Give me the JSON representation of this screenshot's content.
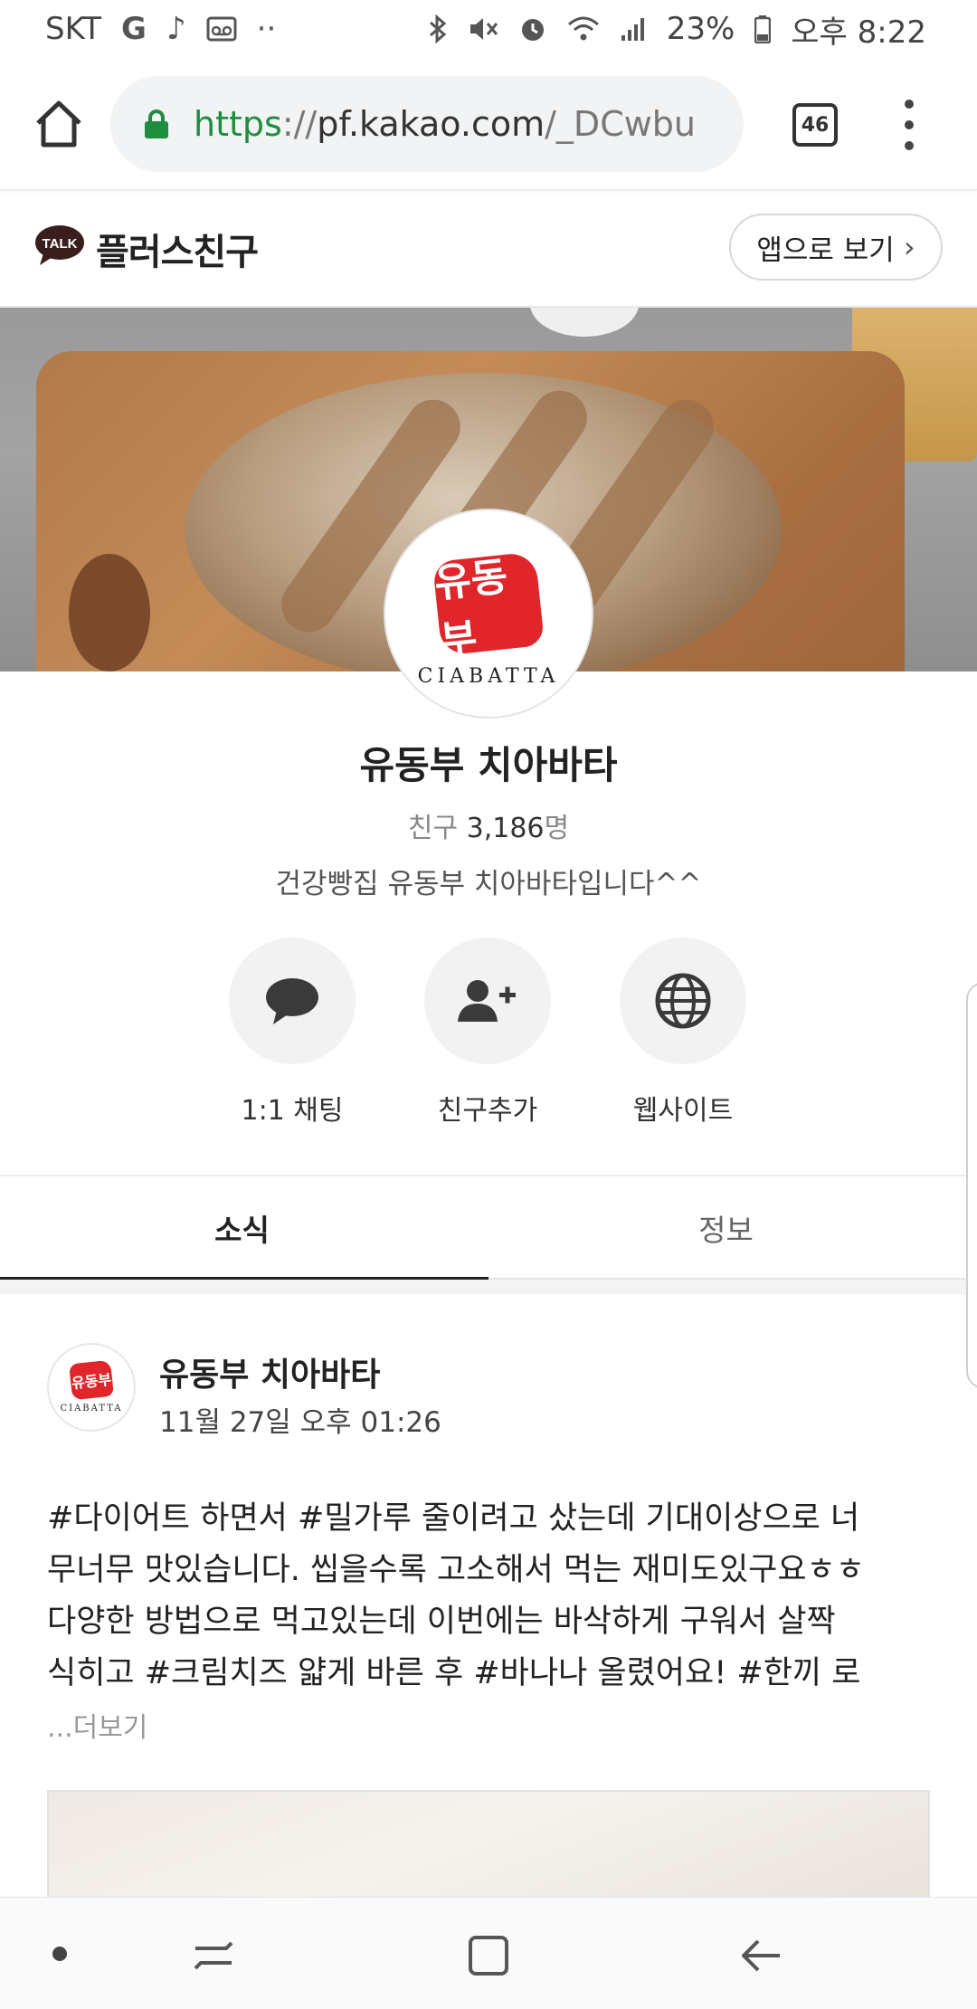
{
  "status_bar": {
    "carrier": "SKT",
    "battery": "23%",
    "time": "오후 8:22"
  },
  "browser": {
    "url_scheme": "https",
    "url_sep": "://",
    "url_host": "pf.kakao.com",
    "url_path": "/_DCwbu",
    "tab_count": "46"
  },
  "kakao_header": {
    "talk_badge": "TALK",
    "title": "플러스친구",
    "open_app_label": "앱으로 보기",
    "open_app_chevron": "›"
  },
  "profile": {
    "logo_text": "유동부",
    "logo_subtext": "CIABATTA",
    "name": "유동부 치아바타",
    "friends_prefix": "친구",
    "friends_count": "3,186",
    "friends_suffix": "명",
    "description": "건강빵집 유동부 치아바타입니다^^"
  },
  "actions": [
    {
      "label": "1:1 채팅",
      "icon": "chat-bubble-icon"
    },
    {
      "label": "친구추가",
      "icon": "add-friend-icon"
    },
    {
      "label": "웹사이트",
      "icon": "globe-icon"
    }
  ],
  "tabs": [
    {
      "label": "소식",
      "active": true
    },
    {
      "label": "정보",
      "active": false
    }
  ],
  "post": {
    "author": "유동부 치아바타",
    "timestamp": "11월 27일 오후 01:26",
    "lines": [
      "#다이어트 하면서 #밀가루 줄이려고 샀는데 기대이상으로 너",
      "무너무 맛있습니다. 씹을수록 고소해서 먹는 재미도있구요ㅎㅎ",
      "다양한 방법으로 먹고있는데 이번에는 바삭하게 구워서 살짝",
      "식히고 #크림치즈 얇게 바른 후 #바나나 올렸어요! #한끼 로"
    ],
    "more": "...더보기"
  },
  "colors": {
    "secure_green": "#1e8e3e",
    "brand_red": "#e0262b",
    "active_tab": "#222222"
  }
}
